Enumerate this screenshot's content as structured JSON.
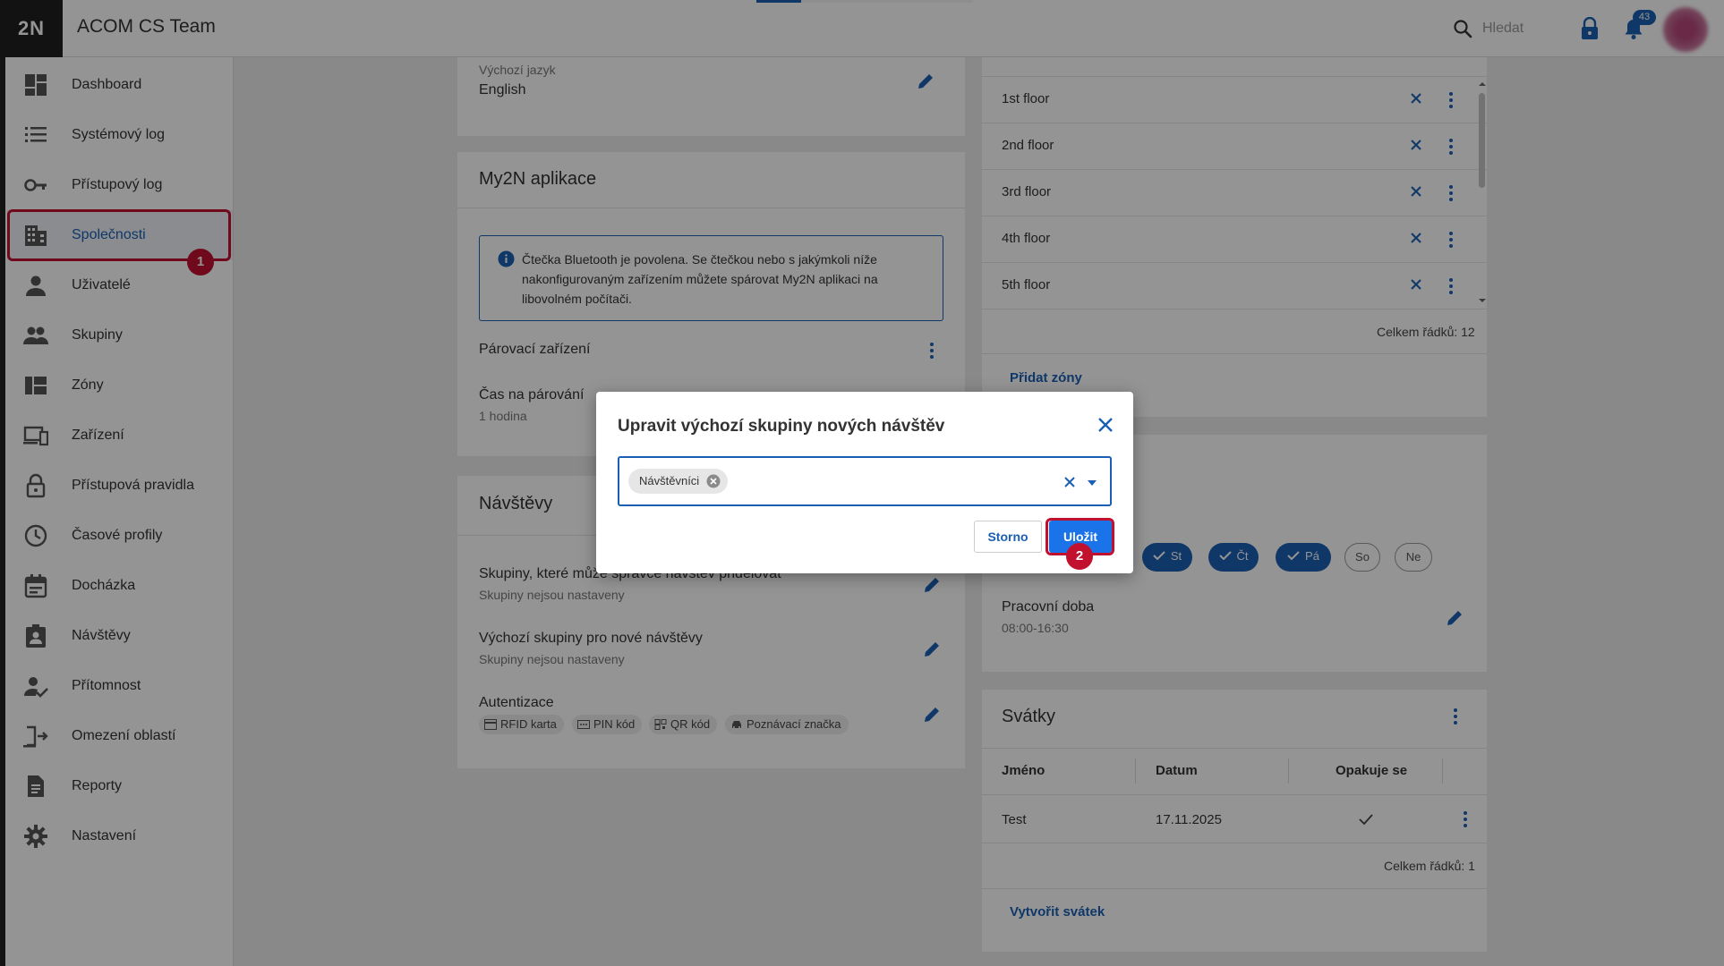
{
  "header": {
    "logo": "2N",
    "title": "ACOM CS Team",
    "search_label": "Hledat",
    "notification_count": "43"
  },
  "sidebar": {
    "items": [
      {
        "label": "Dashboard",
        "icon": "dashboard-icon"
      },
      {
        "label": "Systémový log",
        "icon": "list-icon"
      },
      {
        "label": "Přístupový log",
        "icon": "key-icon"
      },
      {
        "label": "Společnosti",
        "icon": "building-icon",
        "active": true
      },
      {
        "label": "Uživatelé",
        "icon": "person-icon"
      },
      {
        "label": "Skupiny",
        "icon": "group-icon"
      },
      {
        "label": "Zóny",
        "icon": "zones-icon"
      },
      {
        "label": "Zařízení",
        "icon": "devices-icon"
      },
      {
        "label": "Přístupová pravidla",
        "icon": "lock-icon"
      },
      {
        "label": "Časové profily",
        "icon": "clock-icon"
      },
      {
        "label": "Docházka",
        "icon": "calendar-icon"
      },
      {
        "label": "Návštěvy",
        "icon": "visitor-badge-icon"
      },
      {
        "label": "Přítomnost",
        "icon": "person-check-icon"
      },
      {
        "label": "Omezení oblastí",
        "icon": "area-restriction-icon"
      },
      {
        "label": "Reporty",
        "icon": "document-icon"
      },
      {
        "label": "Nastavení",
        "icon": "gear-icon"
      }
    ]
  },
  "annotations": {
    "step1": "1",
    "step2": "2"
  },
  "language": {
    "label": "Výchozí jazyk",
    "value": "English"
  },
  "my2n": {
    "title": "My2N aplikace",
    "info": "Čtečka Bluetooth je povolena. Se čtečkou nebo s jakýmkoli níže nakonfigurovaným zařízením můžete spárovat My2N aplikaci na libovolném počítači.",
    "pairing_device": "Párovací zařízení",
    "pairing_time_label": "Čas na párování",
    "pairing_time_value": "1 hodina"
  },
  "visits": {
    "title": "Návštěvy",
    "groups_label": "Skupiny, které může správce návštěv přidělovat",
    "groups_value": "Skupiny nejsou nastaveny",
    "default_groups_label": "Výchozí skupiny pro nové návštěvy",
    "default_groups_value": "Skupiny nejsou nastaveny",
    "auth_label": "Autentizace",
    "auth_methods": [
      "RFID karta",
      "PIN kód",
      "QR kód",
      "Poznávací značka"
    ]
  },
  "zones": {
    "rows": [
      "1st floor",
      "2nd floor",
      "3rd floor",
      "4th floor",
      "5th floor"
    ],
    "total": "Celkem řádků: 12",
    "add_link": "Přidat zóny"
  },
  "schedule": {
    "days": [
      {
        "label": "St",
        "on": true
      },
      {
        "label": "Čt",
        "on": true
      },
      {
        "label": "Pá",
        "on": true
      },
      {
        "label": "So",
        "on": false
      },
      {
        "label": "Ne",
        "on": false
      }
    ],
    "work_label": "Pracovní doba",
    "work_value": "08:00-16:30"
  },
  "holidays": {
    "title": "Svátky",
    "columns": [
      "Jméno",
      "Datum",
      "Opakuje se"
    ],
    "rows": [
      {
        "name": "Test",
        "date": "17.11.2025",
        "repeat": true
      }
    ],
    "total": "Celkem řádků: 1",
    "create_link": "Vytvořit svátek"
  },
  "dialog": {
    "title": "Upravit výchozí skupiny nových návštěv",
    "selected": [
      "Návštěvníci"
    ],
    "cancel_label": "Storno",
    "save_label": "Uložit"
  },
  "colors": {
    "accent": "#1a5fb4",
    "annotation": "#c2102f"
  }
}
